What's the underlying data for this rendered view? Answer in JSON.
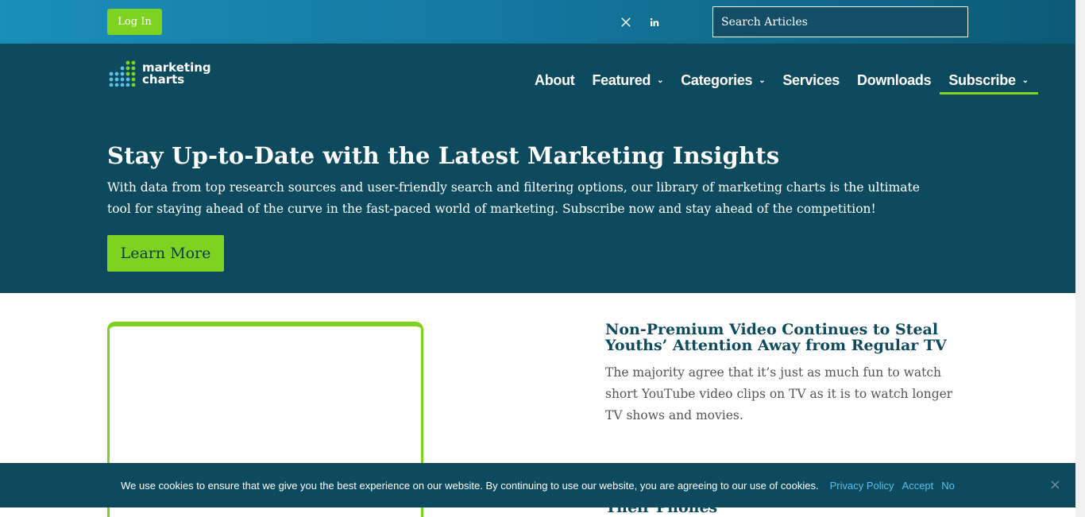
{
  "topbar": {
    "login_label": "Log In",
    "social": [
      "x-icon",
      "linkedin-icon"
    ],
    "search_placeholder": "Search Articles"
  },
  "header": {
    "logo_line1": "marketing",
    "logo_line2": "charts",
    "nav": [
      {
        "label": "About",
        "has_dropdown": false
      },
      {
        "label": "Featured",
        "has_dropdown": true
      },
      {
        "label": "Categories",
        "has_dropdown": true
      },
      {
        "label": "Services",
        "has_dropdown": false
      },
      {
        "label": "Downloads",
        "has_dropdown": false
      },
      {
        "label": "Subscribe",
        "has_dropdown": true,
        "active": true
      }
    ]
  },
  "hero": {
    "title": "Stay Up-to-Date with the Latest Marketing Insights",
    "body": "With data from top research sources and user-friendly search and filtering options, our library of marketing charts is the ultimate tool for staying ahead of the curve in the fast-paced world of marketing. Subscribe now and stay ahead of the competition!",
    "button": "Learn More"
  },
  "articles": [
    {
      "title": "Non-Premium Video Continues to Steal Youths’ Attention Away from Regular TV",
      "excerpt": "The majority agree that it’s just as much fun to watch short YouTube video clips on TV as it is to watch longer TV shows and movies."
    },
    {
      "title": "Their Phones"
    }
  ],
  "cookie": {
    "message": "We use cookies to ensure that we give you the best experience on our website. By continuing to use our website, you are agreeing to our use of cookies.",
    "privacy": "Privacy Policy",
    "accept": "Accept",
    "no": "No",
    "close": "×"
  },
  "colors": {
    "brand_dark": "#0d4a5e",
    "accent_green": "#7ed321",
    "link_blue": "#58c0ea"
  }
}
